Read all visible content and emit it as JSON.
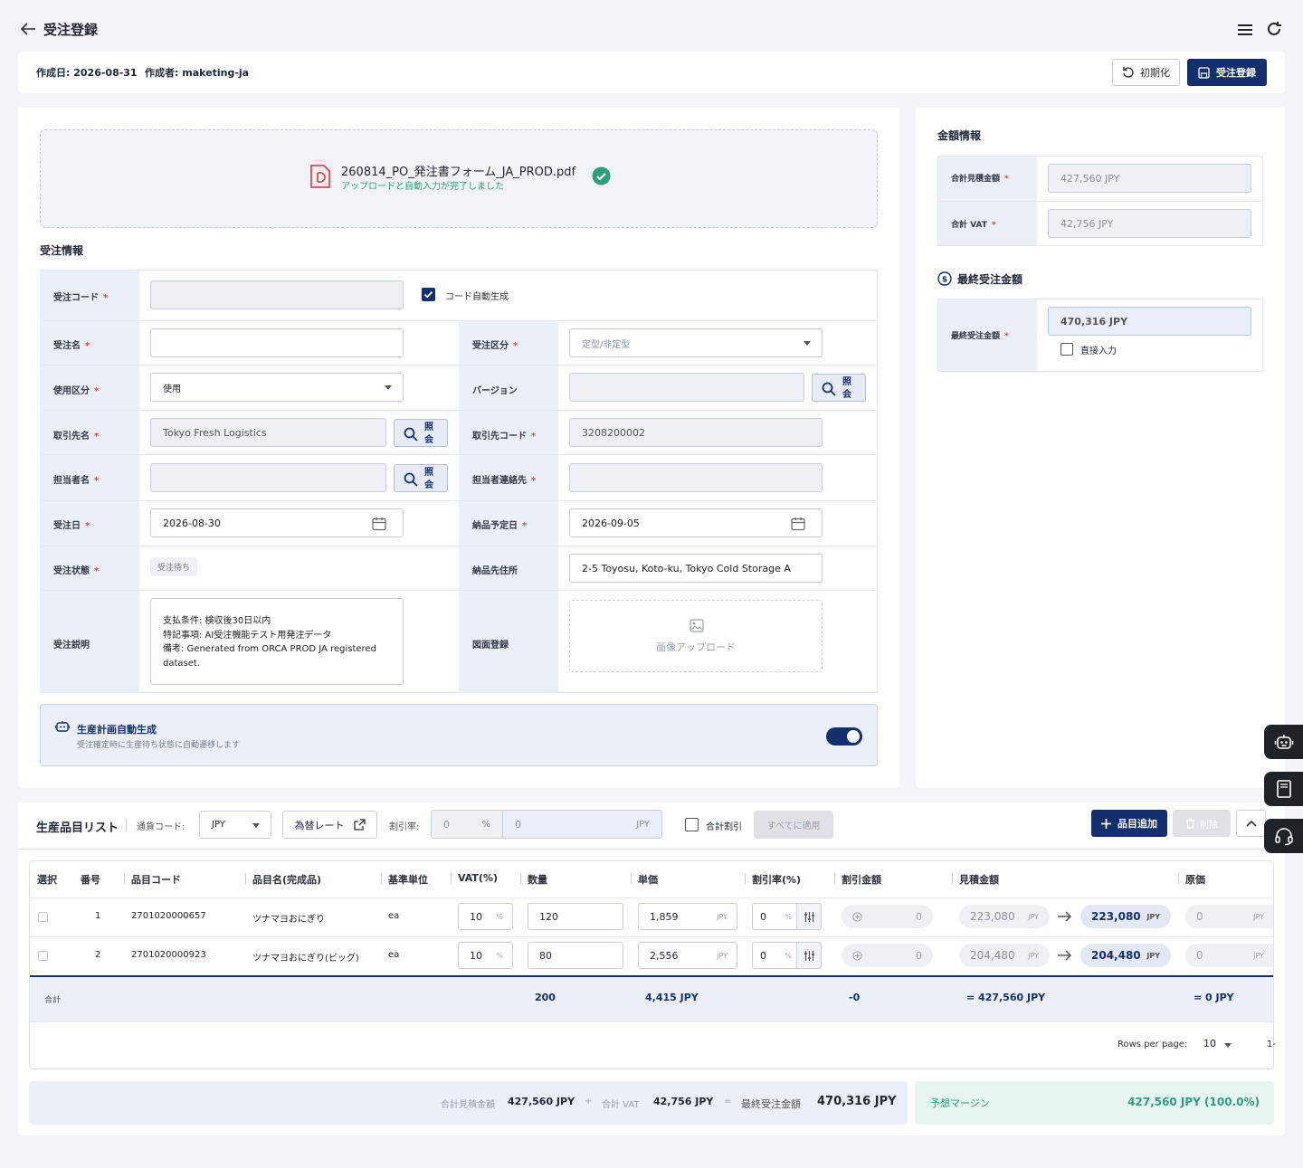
{
  "header": {
    "title": "受注登録"
  },
  "meta": {
    "created": "作成日: 2026-08-31",
    "author": "作成者: maketing-ja",
    "reset_label": "初期化",
    "submit_label": "受注登録"
  },
  "upload": {
    "filename": "260814_PO_発注書フォーム_JA_PROD.pdf",
    "status": "アップロードと自動入力が完了しました"
  },
  "order": {
    "section_title": "受注情報",
    "code_label": "受注コード",
    "autogen_label": "コード自動生成",
    "name_label": "受注名",
    "type_label": "受注区分",
    "type_placeholder": "定型/非定型",
    "usage_label": "使用区分",
    "usage_value": "使用",
    "version_label": "バージョン",
    "client_label": "取引先名",
    "client_value": "Tokyo Fresh Logistics",
    "client_code_label": "取引先コード",
    "client_code_value": "3208200002",
    "manager_label": "担当者名",
    "manager_contact_label": "担当者連絡先",
    "date_label": "受注日",
    "date_value": "2026-08-30",
    "delivery_date_label": "納品予定日",
    "delivery_date_value": "2026-09-05",
    "status_label": "受注状態",
    "status_value": "受注待ち",
    "address_label": "納品先住所",
    "address_value": "2-5 Toyosu, Koto-ku, Tokyo Cold Storage A",
    "desc_label": "受注説明",
    "desc_line1": "支払条件: 検収後30日以内",
    "desc_line2": "特記事項: AI受注機能テスト用発注データ",
    "desc_line3": "備考: Generated from ORCA PROD JA registered",
    "desc_line4": "dataset.",
    "drawing_label": "図面登録",
    "image_upload": "画像アップロード",
    "lookup_a": "照",
    "lookup_b": "会"
  },
  "plan": {
    "title": "生産計画自動生成",
    "desc": "受注確定時に生産待ち状態に自動遷移します"
  },
  "amount": {
    "title": "金額情報",
    "est_label": "合計見積金額",
    "est_value": "427,560 JPY",
    "vat_label": "合計 VAT",
    "vat_value": "42,756 JPY",
    "final_title": "最終受注金額",
    "final_label": "最終受注金額",
    "final_value": "470,316 JPY",
    "direct_label": "直接入力"
  },
  "items": {
    "title": "生産品目リスト",
    "currency_label": "通貨コード:",
    "currency_value": "JPY",
    "rate_label": "為替レート",
    "discount_label": "割引率:",
    "discount_pct": "0",
    "pct": "%",
    "discount_amt": "0",
    "jpy": "JPY",
    "total_discount_label": "合計割引",
    "apply_all": "すべてに適用",
    "add_label": "品目追加",
    "delete_label": "削除",
    "columns": [
      "選択",
      "番号",
      "品目コード",
      "品目名(完成品)",
      "基準単位",
      "VAT(%)",
      "数量",
      "単価",
      "割引率(%)",
      "割引金額",
      "見積金額",
      "原価"
    ],
    "rows": [
      {
        "no": "1",
        "code": "2701020000657",
        "name": "ツナマヨおにぎり",
        "unit": "ea",
        "vat": "10",
        "qty": "120",
        "price": "1,859",
        "rate": "0",
        "disc": "0",
        "est": "223,080",
        "est2": "223,080",
        "cost": "0"
      },
      {
        "no": "2",
        "code": "2701020000923",
        "name": "ツナマヨおにぎり(ビッグ)",
        "unit": "ea",
        "vat": "10",
        "qty": "80",
        "price": "2,556",
        "rate": "0",
        "disc": "0",
        "est": "204,480",
        "est2": "204,480",
        "cost": "0"
      }
    ],
    "total": {
      "label": "合計",
      "qty": "200",
      "price": "4,415 JPY",
      "disc": "-0",
      "est": "= 427,560 JPY",
      "cost": "= 0 JPY"
    },
    "rows_per_page_label": "Rows per page:",
    "rows_per_page": "10",
    "page_info": "1-"
  },
  "summary": {
    "est_label": "合計見積金額",
    "est_value": "427,560 JPY",
    "plus": "+",
    "vat_label": "合計 VAT",
    "vat_value": "42,756 JPY",
    "eq": "=",
    "final_label": "最終受注金額",
    "final_value": "470,316 JPY",
    "margin_label": "予想マージン",
    "margin_value": "427,560 JPY (100.0%)"
  },
  "colors": {
    "primary": "#14306c",
    "success": "#2f9e7e",
    "danger": "#e5484d"
  }
}
